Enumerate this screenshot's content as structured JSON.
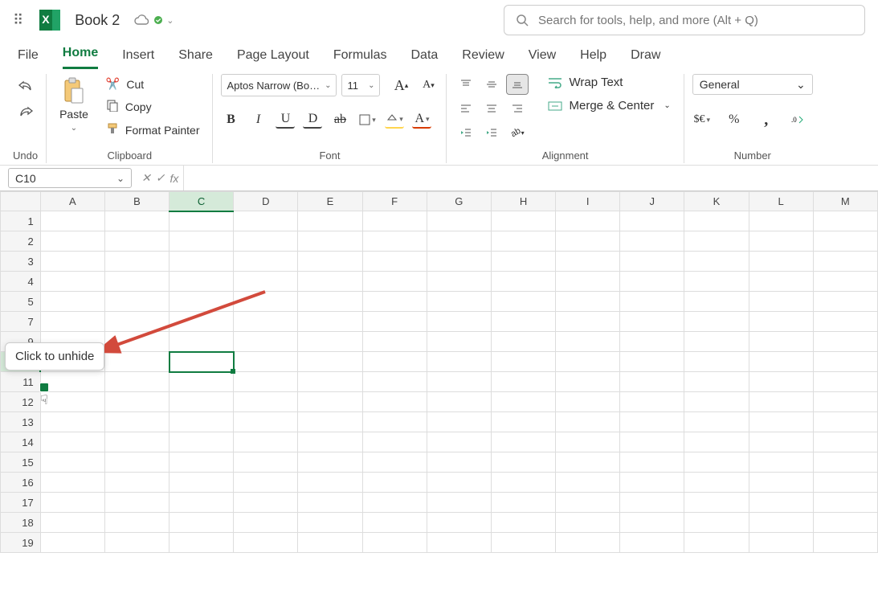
{
  "titlebar": {
    "doc_title": "Book 2",
    "search_placeholder": "Search for tools, help, and more (Alt + Q)"
  },
  "tabs": {
    "items": [
      "File",
      "Home",
      "Insert",
      "Share",
      "Page Layout",
      "Formulas",
      "Data",
      "Review",
      "View",
      "Help",
      "Draw"
    ],
    "active": "Home"
  },
  "ribbon": {
    "undo_label": "Undo",
    "paste_label": "Paste",
    "cut_label": "Cut",
    "copy_label": "Copy",
    "format_painter_label": "Format Painter",
    "clipboard_group": "Clipboard",
    "font_name": "Aptos Narrow (Bo…",
    "font_size": "11",
    "font_group": "Font",
    "wrap_label": "Wrap Text",
    "merge_label": "Merge & Center",
    "align_group": "Alignment",
    "number_format": "General",
    "currency_label": "$€",
    "number_group": "Number"
  },
  "fbar": {
    "name_box": "C10",
    "formula": ""
  },
  "grid": {
    "columns": [
      "A",
      "B",
      "C",
      "D",
      "E",
      "F",
      "G",
      "H",
      "I",
      "J",
      "K",
      "L",
      "M"
    ],
    "rows": [
      "1",
      "2",
      "3",
      "4",
      "5",
      "7",
      "9",
      "10",
      "11",
      "12",
      "13",
      "14",
      "15",
      "16",
      "17",
      "18",
      "19"
    ],
    "hidden_row_after": "5",
    "selected_col": "C",
    "selected_row": "10",
    "selected_cell": "C10"
  },
  "tooltip": {
    "text": "Click to unhide"
  },
  "colors": {
    "accent": "#107c41",
    "arrow": "#d24a3c"
  }
}
